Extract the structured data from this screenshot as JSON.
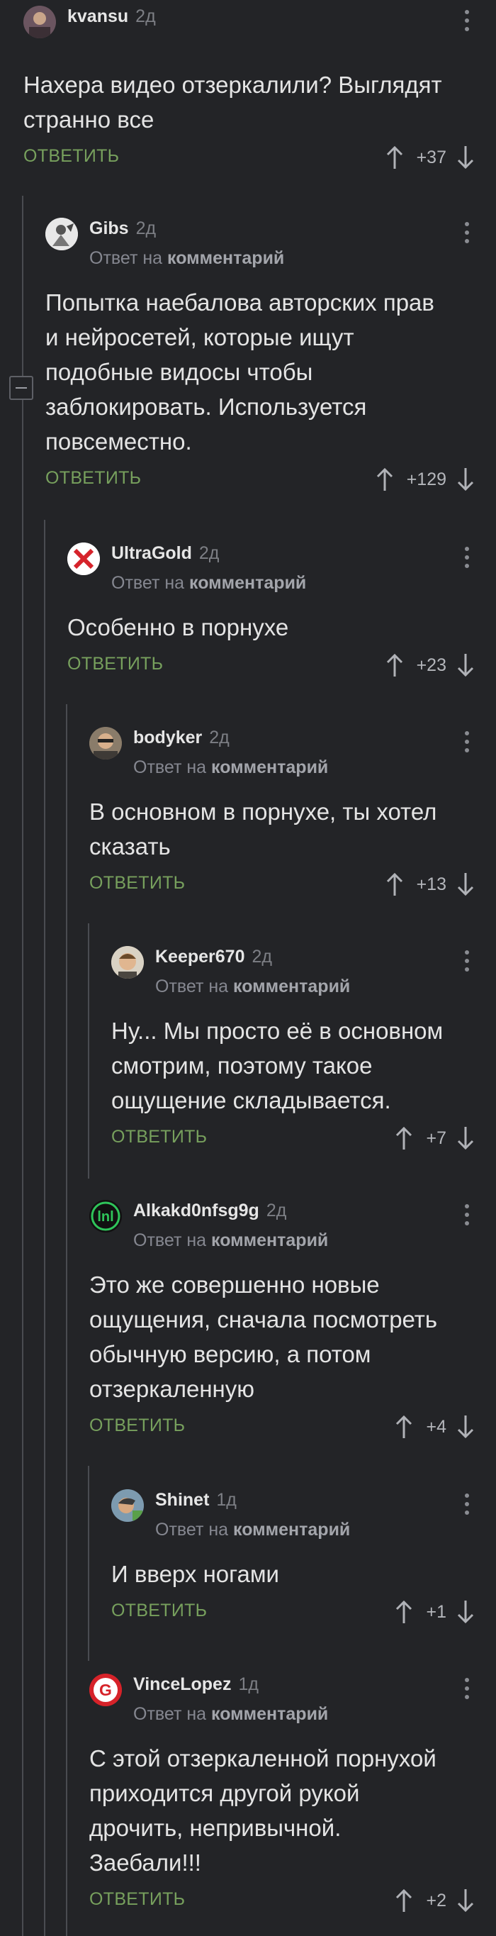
{
  "reply_label": "ОТВЕТИТЬ",
  "answer_to_prefix": "Ответ на",
  "answer_to_link": "комментарий",
  "comments": [
    {
      "user": "kvansu",
      "age": "2д",
      "text": "Нахера видео отзеркалили? Выглядят странно все",
      "rating": "+37"
    },
    {
      "user": "Gibs",
      "age": "2д",
      "text": "Попытка наебалова авторских прав и нейросетей, которые ищут подобные видосы чтобы заблокировать. Используется повсеместно.",
      "rating": "+129"
    },
    {
      "user": "UltraGold",
      "age": "2д",
      "text": "Особенно в порнухе",
      "rating": "+23"
    },
    {
      "user": "bodyker",
      "age": "2д",
      "text": "В основном в порнухе, ты хотел сказать",
      "rating": "+13"
    },
    {
      "user": "Keeper670",
      "age": "2д",
      "text": "Ну... Мы просто её в основном смотрим, поэтому такое ощущение складывается.",
      "rating": "+7"
    },
    {
      "user": "Alkakd0nfsg9g",
      "age": "2д",
      "text": "Это же совершенно новые ощущения,  сначала посмотреть обычную версию, а потом отзеркаленную",
      "rating": "+4"
    },
    {
      "user": "Shinet",
      "age": "1д",
      "text": "И вверх ногами",
      "rating": "+1"
    },
    {
      "user": "VinceLopez",
      "age": "1д",
      "text": "С этой отзеркаленной порнухой приходится другой рукой дрочить, непривычной. Заебали!!!",
      "rating": "+2"
    }
  ],
  "icons": {
    "upvote": "arrow-up-icon",
    "downvote": "arrow-down-icon",
    "menu": "more-vertical-icon",
    "collapse": "minus-icon"
  },
  "colors": {
    "background": "#232427",
    "reply_green": "#77a05d",
    "thread_line": "#4a4c51"
  }
}
